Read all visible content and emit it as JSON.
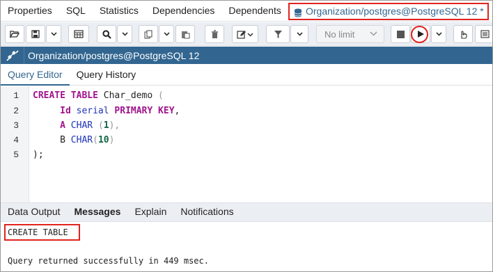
{
  "top_tabs": [
    "Properties",
    "SQL",
    "Statistics",
    "Dependencies",
    "Dependents"
  ],
  "active_tab": "Organization/postgres@PostgreSQL 12 *",
  "toolbar": {
    "limit_label": "No limit"
  },
  "editor_title": "Organization/postgres@PostgreSQL 12",
  "sub_tabs": {
    "query_editor": "Query Editor",
    "query_history": "Query History"
  },
  "code": {
    "line_numbers": [
      "1",
      "2",
      "3",
      "4",
      "5"
    ],
    "l1_kw": "CREATE TABLE",
    "l1_name": " Char_demo ",
    "l1_paren": "(",
    "l2_col": "Id",
    "l2_type": "serial",
    "l2_kw": "PRIMARY KEY",
    "l2_comma": ",",
    "l3_col": "A",
    "l3_type": "CHAR",
    "l3_open": "(",
    "l3_num": "1",
    "l3_close": "),",
    "l4_col": "B",
    "l4_type": "CHAR",
    "l4_open": "(",
    "l4_num": "10",
    "l4_close": ")",
    "l5": ");"
  },
  "bottom_tabs": [
    "Data Output",
    "Messages",
    "Explain",
    "Notifications"
  ],
  "messages": {
    "line1": "CREATE TABLE",
    "line2": "Query returned successfully in 449 msec."
  },
  "colors": {
    "accent": "#326690",
    "highlight": "#e0231e"
  }
}
